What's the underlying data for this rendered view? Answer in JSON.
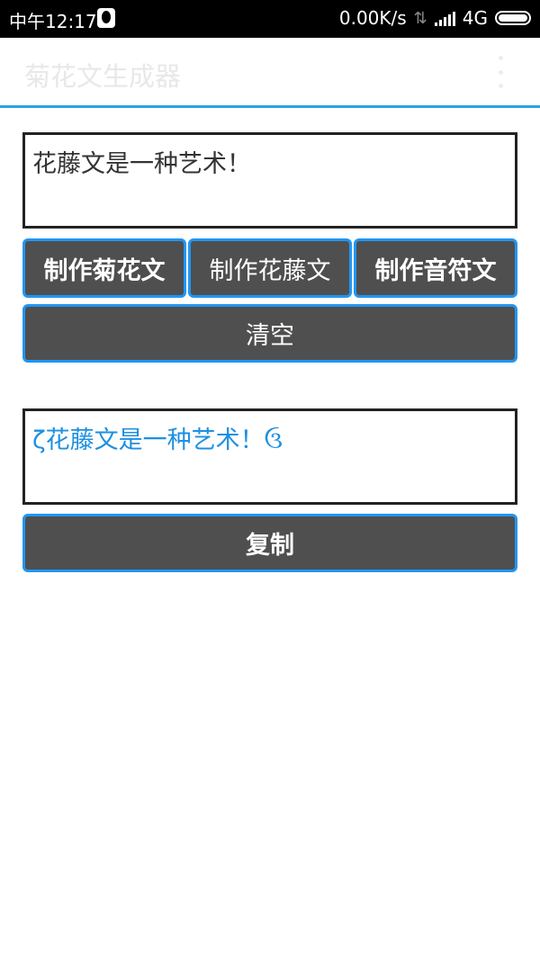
{
  "status_bar": {
    "time": "中午12:17",
    "speed": "0.00K/s",
    "network": "4G"
  },
  "app_bar": {
    "title": "菊花文生成器"
  },
  "input": {
    "value": "花藤文是一种艺术！"
  },
  "buttons": {
    "chrysanthemum": "制作菊花文",
    "vine": "制作花藤文",
    "music": "制作音符文",
    "clear": "清空",
    "copy": "复制"
  },
  "output": {
    "value": "ζ花藤文是一种艺术！ઉ"
  }
}
